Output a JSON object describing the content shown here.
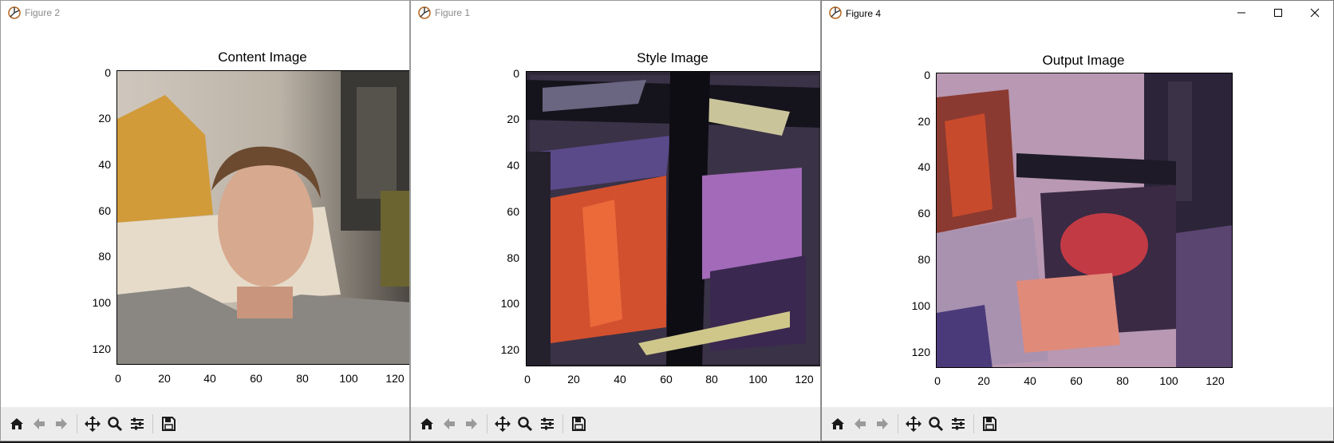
{
  "windows": [
    {
      "id": "w2",
      "title": "Figure 2",
      "plot_title": "Content Image"
    },
    {
      "id": "w1",
      "title": "Figure 1",
      "plot_title": "Style Image"
    },
    {
      "id": "w4",
      "title": "Figure 4",
      "plot_title": "Output Image"
    }
  ],
  "axis": {
    "y_ticks": [
      "0",
      "20",
      "40",
      "60",
      "80",
      "100",
      "120"
    ],
    "x_ticks": [
      "0",
      "20",
      "40",
      "60",
      "80",
      "100",
      "120"
    ],
    "range": [
      0,
      128
    ]
  },
  "toolbar_icons": [
    "home-icon",
    "back-arrow-icon",
    "forward-arrow-icon",
    "pan-icon",
    "zoom-icon",
    "configure-subplots-icon",
    "save-icon"
  ],
  "window_controls": [
    "minimize-icon",
    "maximize-icon",
    "close-icon"
  ]
}
